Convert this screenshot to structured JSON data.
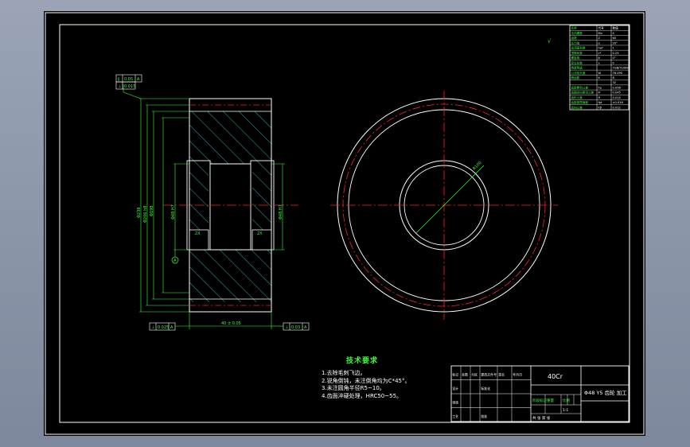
{
  "drawing": {
    "material": "40Cr",
    "part_name": "Φ48 Y5 齿轮 加工",
    "requirements_title": "技术要求",
    "requirements": [
      "1.去除毛刺飞边。",
      "2.锐角倒钝，未注倒角均为C*45°。",
      "3.未注圆角半径R5~10。",
      "4.齿面淬硬处理，HRC50~55。"
    ],
    "gdt": {
      "top_1": {
        "symbol": "∥",
        "value": "0.05",
        "datum": "A"
      },
      "top_2": {
        "symbol": "⊥",
        "value": "0.015"
      },
      "bottom_left": {
        "symbol": "⊥",
        "value": "0.025",
        "datum": "A"
      },
      "bottom_right": {
        "symbol": "⊥",
        "value": "0.03",
        "datum": "A"
      },
      "datum_mark": "A"
    },
    "dimensions": {
      "outer_d1": "Φ238",
      "outer_d2": "Φ206 h8",
      "outer_d3": "Φ198",
      "bore_left": "Φ48 H7",
      "bore_right": "Φ48 H7",
      "face_width": "40 ± 0.05",
      "chamfer_left": "2X",
      "chamfer_right": "2X",
      "radius_label": "R100",
      "roughness_mark": "√"
    },
    "gear_table_rows": [
      [
        "法向模数",
        "Mn",
        "4"
      ],
      [
        "齿数",
        "Z",
        "65"
      ],
      [
        "压力角",
        "α",
        "20°"
      ],
      [
        "齿顶高系数",
        "ha*",
        "1"
      ],
      [
        "顶隙系数",
        "c*",
        "0.25"
      ],
      [
        "螺旋角",
        "β",
        "0°"
      ],
      [
        "变位系数",
        "x",
        "0"
      ],
      [
        "精度等级",
        "",
        "7GB/T10095"
      ],
      [
        "公法线长度",
        "W",
        "76.095"
      ],
      [
        "跨齿数",
        "K",
        "8"
      ],
      [
        "",
        "",
        "32"
      ],
      [
        "齿距累积公差",
        "Fp",
        "0.056"
      ],
      [
        "齿圈径向跳动公差",
        "Fr",
        "0.045"
      ],
      [
        "齿形公差",
        "ff",
        "0.014"
      ],
      [
        "齿距极限偏差",
        "fpt",
        "±0.016"
      ],
      [
        "齿向公差",
        "Fβ",
        "0.012"
      ]
    ],
    "gear_table_header": [
      "名称",
      "代号",
      "数值"
    ],
    "title_block": {
      "row1": [
        "标记",
        "处数",
        "分区",
        "更改文件号",
        "签名",
        "年月日"
      ],
      "row2": [
        "设计",
        "",
        "",
        "标准化",
        "",
        ""
      ],
      "row3": [
        "审核",
        "",
        "",
        "",
        "",
        ""
      ],
      "row4": [
        "工艺",
        "",
        "",
        "批准",
        "",
        ""
      ],
      "stage_label": "阶段标记",
      "weight_label": "重量",
      "scale_label": "比例",
      "scale_value": "1:1",
      "sheet_label": "共    张   第    张"
    }
  },
  "colors": {
    "background": "#000000",
    "frame": "#ffffff",
    "dimension": "#3cff3c",
    "centerline": "#ff2222",
    "hatch": "#3cd2d2",
    "outline": "#ffffff",
    "window_bg": "#8a94a8"
  }
}
